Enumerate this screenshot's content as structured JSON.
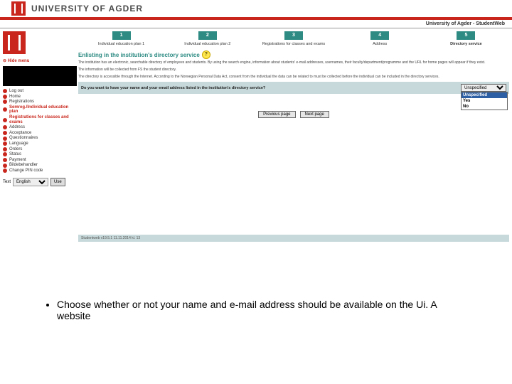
{
  "brand": {
    "name": "UNIVERSITY OF AGDER"
  },
  "sw_header": {
    "title": "University of Agder - StudentWeb"
  },
  "sidebar": {
    "hide_menu": "Hide menu",
    "items": [
      "Log out",
      "Home",
      "Registrations",
      "Semreg./Individual education plan",
      "Registrations for classes and exams",
      "Address",
      "Acceptance",
      "Questionnaires",
      "Language",
      "Orders",
      "Status",
      "Payment",
      "Bildebehandler",
      "Change PIN code"
    ],
    "active_index": 3,
    "lang_label": "Text",
    "lang_value": "English",
    "lang_btn": "Use"
  },
  "progress": {
    "steps": [
      {
        "n": "1",
        "label": "Individual education plan 1"
      },
      {
        "n": "2",
        "label": "Individual education plan 2"
      },
      {
        "n": "3",
        "label": "Registrations for classes and exams"
      },
      {
        "n": "4",
        "label": "Address"
      },
      {
        "n": "5",
        "label": "Directory service"
      }
    ],
    "current_index": 4
  },
  "main": {
    "title": "Enlisting in the institution's directory service",
    "help": "?",
    "p1": "The institution has an electronic, searchable directory of employees and students. By using the search engine, information about students' e-mail addresses, usernames, their faculty/department/programme and the URL for home pages will appear if they exist.",
    "p2": "The information will be collected from FS the student directory.",
    "p3": "The directory is accessible through the Internet. According to the Norwegian Personal Data Act, consent from the individual the data can be related to must be collected before the individual can be included in the directory services.",
    "question": "Do you want to have your name and your email address listed in the institution's directory service?",
    "options": {
      "sel": "Unspecified",
      "o1": "Unspecified",
      "o2": "Yes",
      "o3": "No"
    },
    "prev": "Previous page",
    "next": "Next page",
    "footer": "Studentweb v19.5.1 11.11.2014 kl. 13"
  },
  "bullet": "Choose whether or not your name and e-mail address should be available on the Ui. A website"
}
